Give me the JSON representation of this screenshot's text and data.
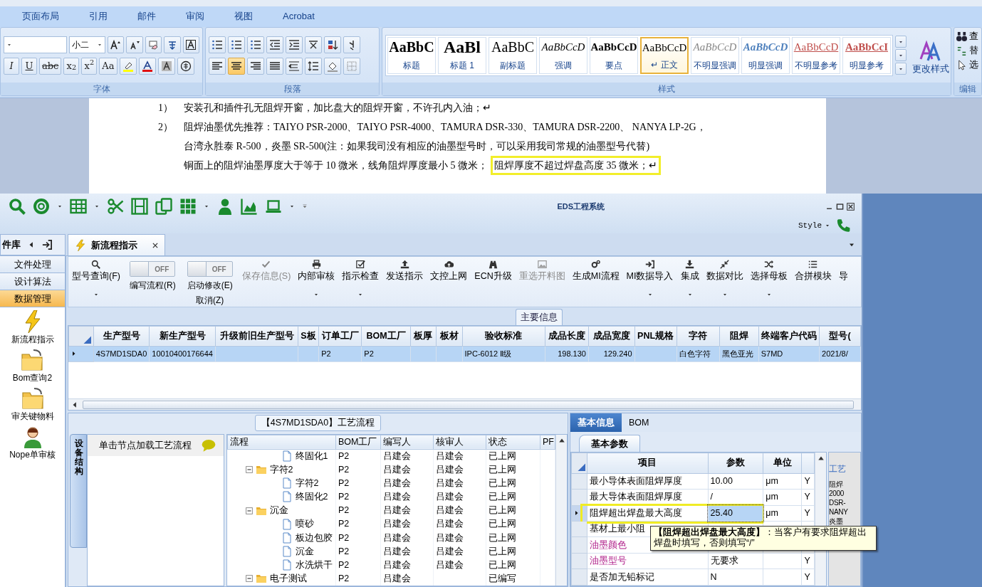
{
  "word": {
    "tabs": [
      {
        "label": "页面布局",
        "selected": false
      },
      {
        "label": "引用",
        "selected": false
      },
      {
        "label": "邮件",
        "selected": false
      },
      {
        "label": "审阅",
        "selected": false
      },
      {
        "label": "视图",
        "selected": false
      },
      {
        "label": "Acrobat",
        "selected": false
      }
    ],
    "font_group": {
      "label": "字体",
      "font_size": "小二",
      "format_buttons": [
        "I",
        "U",
        "abc",
        "x$_{2}$",
        "x$^{2}$",
        "Aa"
      ]
    },
    "paragraph_group": {
      "label": "段落",
      "alignments": [
        {
          "selected": false
        },
        {
          "selected": true
        },
        {
          "selected": false
        },
        {
          "selected": false
        },
        {
          "selected": false
        }
      ]
    },
    "styles_group": {
      "label": "样式",
      "styles": [
        {
          "sample": "AaBbC",
          "label": "标题",
          "selected": false
        },
        {
          "sample": "AaBl",
          "label": "标题 1",
          "selected": false
        },
        {
          "sample": "AaBbC",
          "label": "副标题",
          "selected": false
        },
        {
          "sample": "AaBbCcD",
          "label": "强调",
          "selected": false
        },
        {
          "sample": "AaBbCcD",
          "label": "要点",
          "selected": false
        },
        {
          "sample": "AaBbCcD",
          "label": "↵ 正文",
          "selected": true
        },
        {
          "sample": "AaBbCcD",
          "label": "不明显强调",
          "selected": false
        },
        {
          "sample": "AaBbCcD",
          "label": "明显强调",
          "selected": false
        },
        {
          "sample": "AaBbCcD",
          "label": "不明显参考",
          "selected": false
        },
        {
          "sample": "AaBbCcI",
          "label": "明显参考",
          "selected": false
        }
      ],
      "change_styles": "更改样式"
    },
    "editing_group": {
      "label": "编辑",
      "items": [
        "查",
        "替",
        "选"
      ]
    },
    "document": {
      "lines": [
        {
          "number": "1）",
          "segments": [
            {
              "text": "安装孔和插件孔无阻焊开窗，加比盘大的阻焊开窗，不许孔内入油；↵",
              "highlighted": false
            }
          ]
        },
        {
          "number": "2）",
          "segments": [
            {
              "text": "阻焊油墨优先推荐：TAIYO PSR-2000、TAIYO PSR-4000、TAMURA   DSR-330、TAMURA DSR-2200、 NANYA LP-2G，",
              "highlighted": false
            }
          ]
        },
        {
          "segments": [
            {
              "text": "台湾永胜泰 R-500，炎墨 SR-500(注：如果我司没有相应的油墨型号时，可以采用我司常规的油墨型号代替)",
              "highlighted": false
            }
          ]
        },
        {
          "segments": [
            {
              "text": "铜面上的阻焊油墨厚度大于等于 10 微米，线角阻焊厚度最小 5 微米；",
              "highlighted": false
            },
            {
              "text": "阻焊厚度不超过焊盘高度 35 微米；↵",
              "highlighted": true
            }
          ]
        }
      ]
    }
  },
  "app": {
    "title": "EDS工程系统",
    "style_menu": "Style",
    "nav": {
      "header": "件库",
      "sections": [
        {
          "label": "文件处理",
          "selected": false
        },
        {
          "label": "设计算法",
          "selected": false
        },
        {
          "label": "数据管理",
          "selected": true
        }
      ],
      "items": [
        {
          "label": "新流程指示",
          "kind": "lightning"
        },
        {
          "label": "Bom查询2",
          "kind": "folder"
        },
        {
          "label": "审关键物料",
          "kind": "folder"
        },
        {
          "label": "Nope单审核",
          "kind": "person"
        }
      ]
    },
    "tabs": [
      {
        "label": "新流程指示",
        "selected": true
      }
    ],
    "toolbar": [
      {
        "kind": "button",
        "label": "型号查询(F)",
        "dropdown": true,
        "disabled": false
      },
      {
        "kind": "toggle",
        "label": "编写流程(R)",
        "state_text": "OFF",
        "on": false
      },
      {
        "kind": "toggle",
        "label": "启动修改(E)",
        "sub_label": "取消(Z)",
        "state_text": "OFF",
        "on": false
      },
      {
        "kind": "button",
        "label": "保存信息(S)",
        "dropdown": false,
        "disabled": true
      },
      {
        "kind": "button",
        "label": "内部审核",
        "dropdown": true,
        "disabled": false
      },
      {
        "kind": "button",
        "label": "指示检查",
        "dropdown": true,
        "disabled": false
      },
      {
        "kind": "button",
        "label": "发送指示",
        "dropdown": false,
        "disabled": false
      },
      {
        "kind": "button",
        "label": "文控上网",
        "dropdown": false,
        "disabled": false
      },
      {
        "kind": "button",
        "label": "ECN升级",
        "dropdown": false,
        "disabled": false
      },
      {
        "kind": "button",
        "label": "重选开料图",
        "dropdown": false,
        "disabled": true
      },
      {
        "kind": "button",
        "label": "生成MI流程",
        "dropdown": false,
        "disabled": false
      },
      {
        "kind": "button",
        "label": "MI数据导入",
        "dropdown": true,
        "disabled": false
      },
      {
        "kind": "button",
        "label": "集成",
        "dropdown": true,
        "disabled": false
      },
      {
        "kind": "button",
        "label": "数据对比",
        "dropdown": true,
        "disabled": false
      },
      {
        "kind": "button",
        "label": "选择母板",
        "dropdown": true,
        "disabled": false
      },
      {
        "kind": "button",
        "label": "合拼模块",
        "dropdown": false,
        "disabled": false
      },
      {
        "kind": "button",
        "label": "导",
        "dropdown": false,
        "disabled": false
      }
    ],
    "main_info": {
      "title": "主要信息",
      "columns": [
        "生产型号",
        "新生产型号",
        "升级前旧生产型号",
        "S板",
        "订单工厂",
        "BOM工厂",
        "板厚",
        "板材",
        "验收标准",
        "成品长度",
        "成品宽度",
        "PNL规格",
        "字符",
        "阻焊",
        "终端客户代码",
        "型号("
      ],
      "rows": [
        {
          "selected": true,
          "cells": [
            "4S7MD1SDA0",
            "10010400176644",
            null,
            null,
            "P2",
            "P2",
            null,
            null,
            "IPC-6012 Ⅱ级",
            "198.130",
            "129.240",
            null,
            "白色字符",
            "黑色亚光",
            "S7MD",
            "2021/8/"
          ]
        }
      ]
    },
    "process": {
      "title": "【4S7MD1SDA0】工艺流程",
      "side_tab": "设备结构",
      "hint": "单击节点加载工艺流程",
      "columns": [
        "流程",
        "BOM工厂",
        "编写人",
        "核审人",
        "状态",
        "PF"
      ],
      "tree": [
        {
          "kind": "file",
          "label": "终固化1",
          "bom": "P2",
          "author": "吕建会",
          "reviewer": "吕建会",
          "status": "已上网"
        },
        {
          "kind": "folder",
          "label": "字符2",
          "bom": "P2",
          "author": "吕建会",
          "reviewer": "吕建会",
          "status": "已上网",
          "expanded": true,
          "children": [
            {
              "kind": "file",
              "label": "字符2",
              "bom": "P2",
              "author": "吕建会",
              "reviewer": "吕建会",
              "status": "已上网"
            },
            {
              "kind": "file",
              "label": "终固化2",
              "bom": "P2",
              "author": "吕建会",
              "reviewer": "吕建会",
              "status": "已上网"
            }
          ]
        },
        {
          "kind": "folder",
          "label": "沉金",
          "bom": "P2",
          "author": "吕建会",
          "reviewer": "吕建会",
          "status": "已上网",
          "expanded": true,
          "children": [
            {
              "kind": "file",
              "label": "喷砂",
              "bom": "P2",
              "author": "吕建会",
              "reviewer": "吕建会",
              "status": "已上网"
            },
            {
              "kind": "file",
              "label": "板边包胶",
              "bom": "P2",
              "author": "吕建会",
              "reviewer": "吕建会",
              "status": "已上网"
            },
            {
              "kind": "file",
              "label": "沉金",
              "bom": "P2",
              "author": "吕建会",
              "reviewer": "吕建会",
              "status": "已上网"
            },
            {
              "kind": "file",
              "label": "水洗烘干",
              "bom": "P2",
              "author": "吕建会",
              "reviewer": "吕建会",
              "status": "已上网"
            }
          ]
        },
        {
          "kind": "folder",
          "label": "电子测试",
          "bom": "P2",
          "author": "吕建会",
          "status": "已编写",
          "expanded": true
        }
      ]
    },
    "info": {
      "tabs": [
        {
          "label": "基本信息",
          "selected": true
        },
        {
          "label": "BOM",
          "selected": false
        }
      ],
      "subtab": "基本参数",
      "columns": [
        "项目",
        "参数",
        "单位"
      ],
      "rows": [
        {
          "item": "最小导体表面阻焊厚度",
          "value": "10.00",
          "unit": "μm",
          "flag": "Y",
          "kind": "normal",
          "selected": false,
          "highlighted": false
        },
        {
          "item": "最大导体表面阻焊厚度",
          "value": "/",
          "unit": "μm",
          "flag": "Y",
          "kind": "normal",
          "selected": false,
          "highlighted": false
        },
        {
          "item": "阻焊超出焊盘最大高度",
          "value": "25.40",
          "unit": "μm",
          "flag": "Y",
          "kind": "normal",
          "selected": true,
          "highlighted": true,
          "tooltip": "**【阻焊超出焊盘最大高度】**：当客户有要求阻焊超出焊盘时填写，否则填写“/”"
        },
        {
          "item": "基材上最小阻",
          "kind": "normal",
          "selected": false,
          "highlighted": false
        },
        {
          "item": "油墨颜色",
          "kind": "ink",
          "selected": false,
          "highlighted": false
        },
        {
          "item": "油墨型号",
          "value": "无要求",
          "flag": "Y",
          "kind": "ink",
          "selected": false,
          "highlighted": false
        },
        {
          "item": "是否加无铅标记",
          "value": "N",
          "flag": "Y",
          "kind": "normal",
          "selected": false,
          "highlighted": false
        }
      ],
      "side_header": "工艺",
      "side_lines": [
        "阻焊",
        "2000",
        "DSR-",
        "NANY",
        "炎墨"
      ]
    }
  }
}
